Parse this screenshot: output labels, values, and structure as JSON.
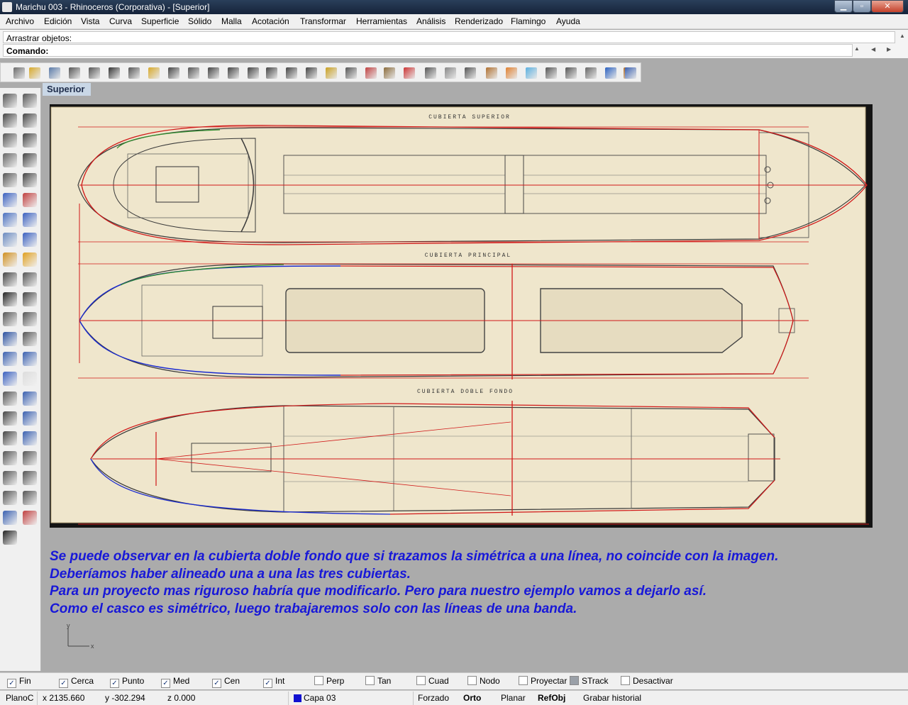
{
  "window": {
    "title": "Marichu 003 - Rhinoceros (Corporativa) - [Superior]",
    "min_glyph": "▁",
    "max_glyph": "▫",
    "close_glyph": "✕"
  },
  "menu": [
    "Archivo",
    "Edición",
    "Vista",
    "Curva",
    "Superficie",
    "Sólido",
    "Malla",
    "Acotación",
    "Transformar",
    "Herramientas",
    "Análisis",
    "Renderizado",
    "Flamingo",
    "Ayuda"
  ],
  "command": {
    "history": "Arrastrar objetos:",
    "prompt": "Comando:"
  },
  "viewport": {
    "title": "Superior",
    "axis_y": "y",
    "axis_x": "x"
  },
  "drawing": {
    "deck_superior": "CUBIERTA SUPERIOR",
    "deck_principal": "CUBIERTA PRINCIPAL",
    "deck_doble_fondo": "CUBIERTA DOBLE FONDO"
  },
  "annotation": [
    "Se puede observar en la cubierta doble fondo que si trazamos la simétrica a una línea, no  coincide con la imagen.",
    "Deberíamos haber alineado una a una las tres cubiertas.",
    "Para un proyecto mas riguroso habría que modificarlo. Pero para nuestro ejemplo vamos a dejarlo así.",
    "Como el casco es simétrico, luego trabajaremos solo con las líneas de una banda."
  ],
  "osnaps": [
    {
      "label": "Fin",
      "checked": true
    },
    {
      "label": "Cerca",
      "checked": true
    },
    {
      "label": "Punto",
      "checked": true
    },
    {
      "label": "Med",
      "checked": true
    },
    {
      "label": "Cen",
      "checked": true
    },
    {
      "label": "Int",
      "checked": true
    },
    {
      "label": "Perp",
      "checked": false
    },
    {
      "label": "Tan",
      "checked": false
    },
    {
      "label": "Cuad",
      "checked": false
    },
    {
      "label": "Nodo",
      "checked": false
    },
    {
      "label": "Proyectar",
      "checked": false
    },
    {
      "label": "STrack",
      "checked": false
    },
    {
      "label": "Desactivar",
      "checked": false
    }
  ],
  "status": {
    "cplane": "PlanoC",
    "x": "x 2135.660",
    "y": "y -302.294",
    "z": "z 0.000",
    "layer": "Capa 03",
    "layer_color": "#1010d0",
    "forzado": "Forzado",
    "orto": "Orto",
    "planar": "Planar",
    "refobj": "RefObj",
    "historial": "Grabar historial"
  },
  "colors": {
    "annotation": "#1818d8",
    "hull_red": "#d01818",
    "hull_blue": "#1a2ad0",
    "hull_green": "#2a8a2a",
    "paper": "#efe6cc"
  },
  "toolbar_icons": [
    "new-file-icon",
    "open-file-icon",
    "save-icon",
    "print-icon",
    "import-icon",
    "cut-icon",
    "copy-icon",
    "paste-icon",
    "undo-icon",
    "pan-icon",
    "rotate-view-icon",
    "zoom-icon",
    "zoom-window-icon",
    "zoom-extents-icon",
    "zoom-selected-icon",
    "zoom-dynamic-icon",
    "viewport-4-icon",
    "snap-icon",
    "layer-icon",
    "properties-icon",
    "render-icon",
    "material-icon",
    "light-icon",
    "shade-icon",
    "texture-icon",
    "color-icon",
    "dimension-icon",
    "group-icon",
    "block-icon",
    "cloud-icon",
    "plugin-icon",
    "settings-icon",
    "wand-icon",
    "help-icon"
  ],
  "left_tool_icons": [
    "select-arrow-icon",
    "point-icon",
    "polyline-icon",
    "curve-icon",
    "circle-icon",
    "ellipse-icon",
    "arc-icon",
    "rectangle-icon",
    "polygon-icon",
    "fillet-icon",
    "freeform-icon",
    "loft-icon",
    "box-icon",
    "sphere-icon",
    "cylinder-icon",
    "planar-surface-icon",
    "gear-icon",
    "split-icon",
    "trim-icon",
    "extend-icon",
    "boolean-icon",
    "offset-icon",
    "join-icon",
    "explode-icon",
    "text-icon",
    "dimension-icon",
    "array-icon",
    "mirror-icon",
    "solid-icon",
    "hatch-icon",
    "xyz-icon",
    "grid-icon",
    "move-icon",
    "copy-icon",
    "scale-icon",
    "rotate-icon",
    "align-icon",
    "transform-icon",
    "edit-points-icon",
    "curvature-icon",
    "analyze-icon",
    "group-icon",
    "layer-icon",
    "render-icon",
    "check-icon"
  ]
}
